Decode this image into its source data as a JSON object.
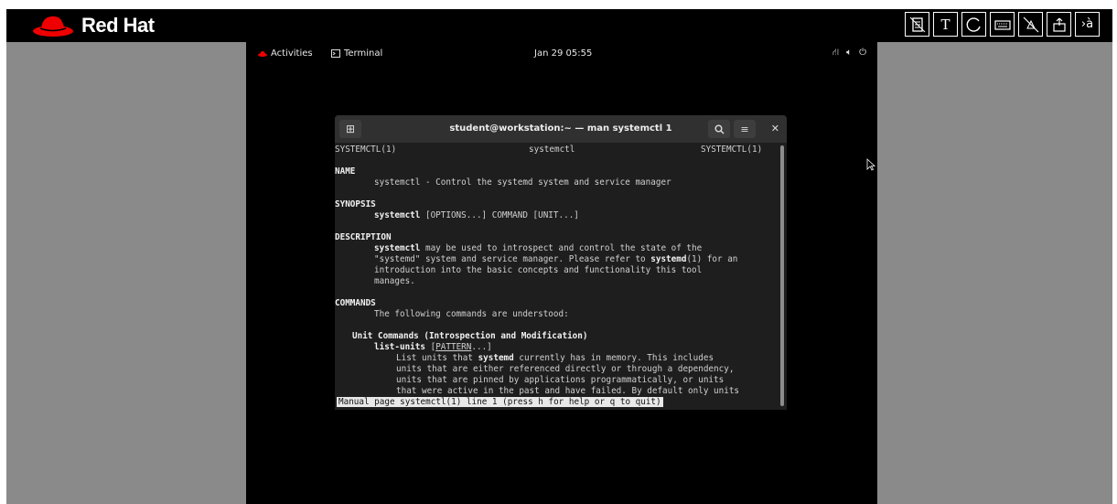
{
  "brand": {
    "name": "Red Hat"
  },
  "toolbar": {
    "text_tool": "T",
    "lang_tool": "›à"
  },
  "topbar": {
    "activities": "Activities",
    "terminal": "Terminal",
    "clock": "Jan 29  05:55"
  },
  "window": {
    "title": "student@workstation:~ — man systemctl 1"
  },
  "man": {
    "h_left": "SYSTEMCTL(1)",
    "h_center": "systemctl",
    "h_right": "SYSTEMCTL(1)",
    "name_h": "NAME",
    "name_text": "systemctl - Control the systemd system and service manager",
    "syn_h": "SYNOPSIS",
    "syn_cmd": "systemctl",
    "syn_args": " [OPTIONS...] COMMAND [UNIT...]",
    "desc_h": "DESCRIPTION",
    "desc1_a": "systemctl",
    "desc1_b": " may be used to introspect and control the state of the",
    "desc2_a": "\"systemd\" system and service manager. Please refer to ",
    "desc2_b": "systemd",
    "desc2_c": "(1) for an",
    "desc3": "introduction into the basic concepts and functionality this tool",
    "desc4": "manages.",
    "cmd_h": "COMMANDS",
    "cmd_text": "The following commands are understood:",
    "unit_h": "Unit Commands (Introspection and Modification)",
    "lu_cmd": "list-units",
    "lu_args_a": " [",
    "lu_args_b": "PATTERN",
    "lu_args_c": "...]",
    "lu1_a": "List units that ",
    "lu1_b": "systemd",
    "lu1_c": " currently has in memory. This includes",
    "lu2": "units that are either referenced directly or through a dependency,",
    "lu3": "units that are pinned by applications programmatically, or units",
    "lu4": "that were active in the past and have failed. By default only units",
    "status": "Manual page systemctl(1) line 1 (press h for help or q to quit)"
  }
}
